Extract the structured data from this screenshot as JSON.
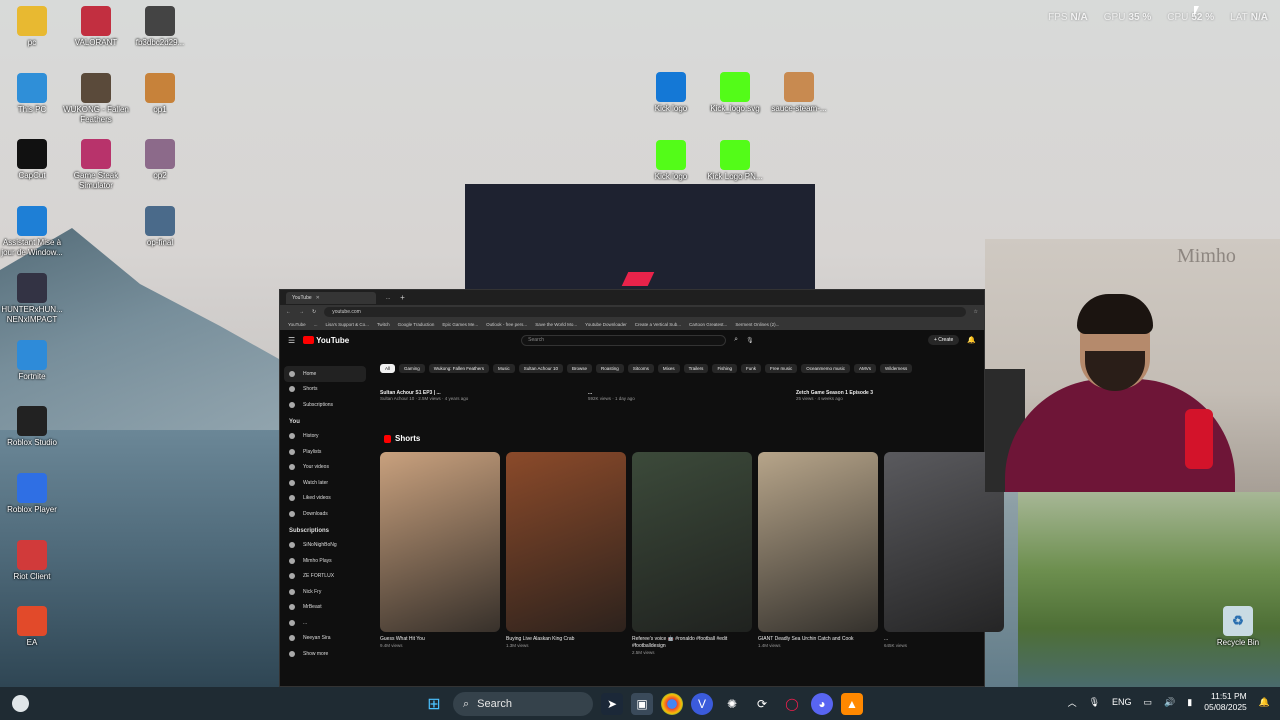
{
  "overlay_stats": [
    {
      "key": "FPS",
      "value": "N/A"
    },
    {
      "key": "GPU",
      "value": "35 %"
    },
    {
      "key": "CPU",
      "value": "52 %"
    },
    {
      "key": "LAT",
      "value": "N/A"
    }
  ],
  "desktop_icons_left": [
    {
      "label": "pc",
      "color": "#e8b931"
    },
    {
      "label": "This PC",
      "color": "#2f8fd8"
    },
    {
      "label": "CapCut",
      "color": "#111111"
    },
    {
      "label": "Assistant Mise à jour de Window...",
      "color": "#1e7fd6"
    },
    {
      "label": "HUNTERxHUN... NENxIMPACT",
      "color": "#333344"
    },
    {
      "label": "Fortnite",
      "color": "#2e8bd9"
    },
    {
      "label": "Roblox Studio",
      "color": "#222222"
    },
    {
      "label": "Roblox Player",
      "color": "#2f6fe4"
    },
    {
      "label": "Riot Client",
      "color": "#d13a3a"
    },
    {
      "label": "EA",
      "color": "#e24a2a"
    }
  ],
  "desktop_icons_col2": [
    {
      "label": "VALORANT",
      "color": "#c22f40"
    },
    {
      "label": "WUKONG - Fallen Feathers",
      "color": "#5a4a3a"
    },
    {
      "label": "Game Steak Simulator",
      "color": "#b8336b"
    }
  ],
  "desktop_icons_col3": [
    {
      "label": "fb3dbc2d29...",
      "color": "#444444"
    },
    {
      "label": "op1",
      "color": "#c7823a"
    },
    {
      "label": "op2",
      "color": "#8c6a8a"
    },
    {
      "label": "op-final",
      "color": "#4a6a8a"
    }
  ],
  "desktop_icons_center": [
    {
      "label": "Kick logo",
      "color": "#1478d6"
    },
    {
      "label": "Kick_logo.svg",
      "color": "#53fc18"
    },
    {
      "label": "sauce-steam-...",
      "color": "#c88a50"
    },
    {
      "label": "Kick logo",
      "color": "#53fc18"
    },
    {
      "label": "Kick Logo PN...",
      "color": "#53fc18"
    }
  ],
  "recycle_bin": {
    "label": "Recycle Bin"
  },
  "webcam": {
    "watermark": "Mimho"
  },
  "browser": {
    "tabs": [
      {
        "label": "YouTube",
        "active": true
      },
      {
        "label": "...",
        "active": false
      }
    ],
    "url": "youtube.com",
    "bookmarks": [
      "YouTube",
      "...",
      "Lisa's Support & Co...",
      "Twitch",
      "Google Traduction",
      "Epic Games Me...",
      "Outlook - free pers...",
      "Save the World Mo...",
      "Youtube Downloader",
      "Create a Vertical Sub...",
      "Cartoon Greatest...",
      "Serment Onlines (2)..."
    ],
    "yt_logo": "YouTube",
    "search_placeholder": "Search",
    "create_label": "+ Create",
    "sidebar_main": [
      "Home",
      "Shorts",
      "Subscriptions"
    ],
    "sidebar_you_header": "You",
    "sidebar_you": [
      "History",
      "Playlists",
      "Your videos",
      "Watch later",
      "Liked videos",
      "Downloads"
    ],
    "sidebar_subs_header": "Subscriptions",
    "sidebar_subs": [
      "SiNoNighBoNg",
      "Mimho Plays",
      "ZE FORTLUX",
      "Nick Fry",
      "MrBeast",
      "...",
      "Neeyan Sira",
      "Show more"
    ],
    "chips": [
      "All",
      "Gaming",
      "Wukong: Fallen Feathers",
      "Music",
      "Sultan Achour 10",
      "Browse",
      "Roasting",
      "Sitcoms",
      "Mixes",
      "Trailers",
      "Fishing",
      "Funk",
      "Free music",
      "Oceanmemo music",
      "AMVs",
      "Wilderness"
    ],
    "videos": [
      {
        "title": "Sultan Achour S1 EP3 | ...",
        "meta": "Sultan Achour 10 · 2.5M views · 4 years ago"
      },
      {
        "title": "...",
        "meta": "592K views · 1 day ago"
      },
      {
        "title": "Zetch Game Season 1 Episode 3",
        "meta": "25 views · 4 weeks ago"
      }
    ],
    "shorts_header": "Shorts",
    "shorts": [
      {
        "title": "Guess What Hit You",
        "meta": "9.4M views",
        "color": "#c9a17e"
      },
      {
        "title": "Buying Live Alaskan King Crab",
        "meta": "1.3M views",
        "color": "#8b4a2a"
      },
      {
        "title": "Referee's voice 🤖 #ronaldo #football #edit #footballdesign",
        "meta": "2.5M views",
        "color": "#3c4a3a"
      },
      {
        "title": "GIANT Deadly Sea Urchin Catch and Cook",
        "meta": "1.4M views",
        "color": "#b7a58a"
      },
      {
        "title": "...",
        "meta": "645K views",
        "color": "#5a5a5e"
      }
    ]
  },
  "taskbar": {
    "search_label": "Search",
    "language": "ENG",
    "time": "11:51 PM",
    "date": "05/08/2025"
  }
}
